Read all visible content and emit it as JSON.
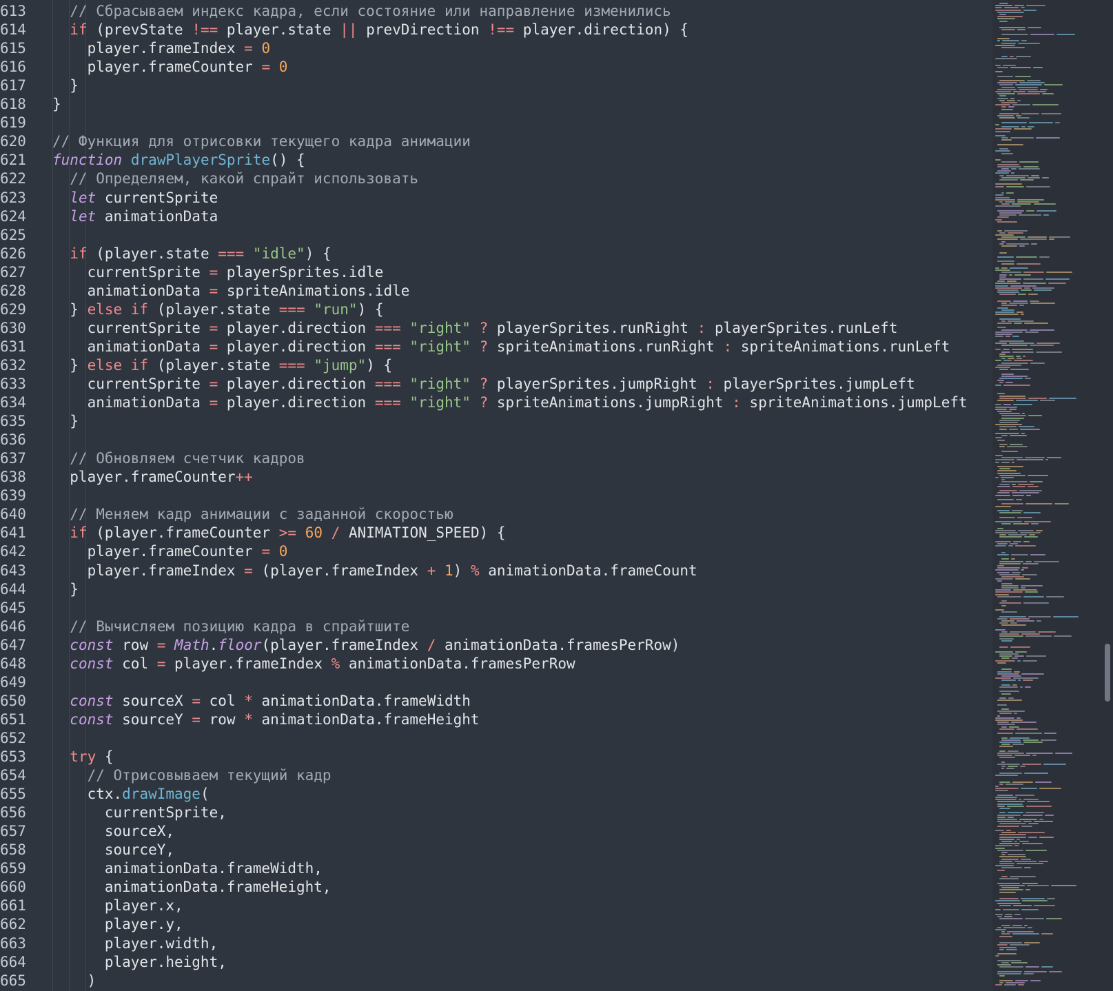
{
  "editor": {
    "lines": [
      {
        "n": "613",
        "t": [
          [
            "cm",
            "  // Сбрасываем индекс кадра, если состояние или направление изменились"
          ]
        ]
      },
      {
        "n": "614",
        "t": [
          [
            "pl",
            "  "
          ],
          [
            "kw",
            "if"
          ],
          [
            "pl",
            " (prevState "
          ],
          [
            "op",
            "!=="
          ],
          [
            "pl",
            " player.state "
          ],
          [
            "op",
            "||"
          ],
          [
            "pl",
            " prevDirection "
          ],
          [
            "op",
            "!=="
          ],
          [
            "pl",
            " player.direction) {"
          ]
        ]
      },
      {
        "n": "615",
        "t": [
          [
            "pl",
            "    player.frameIndex "
          ],
          [
            "op",
            "="
          ],
          [
            "pl",
            " "
          ],
          [
            "num",
            "0"
          ]
        ]
      },
      {
        "n": "616",
        "t": [
          [
            "pl",
            "    player.frameCounter "
          ],
          [
            "op",
            "="
          ],
          [
            "pl",
            " "
          ],
          [
            "num",
            "0"
          ]
        ]
      },
      {
        "n": "617",
        "t": [
          [
            "pl",
            "  }"
          ]
        ]
      },
      {
        "n": "618",
        "t": [
          [
            "pl",
            "}"
          ]
        ]
      },
      {
        "n": "619",
        "t": []
      },
      {
        "n": "620",
        "t": [
          [
            "cm",
            "// Функция для отрисовки текущего кадра анимации"
          ]
        ]
      },
      {
        "n": "621",
        "t": [
          [
            "sk",
            "function"
          ],
          [
            "pl",
            " "
          ],
          [
            "fn",
            "drawPlayerSprite"
          ],
          [
            "pl",
            "() {"
          ]
        ]
      },
      {
        "n": "622",
        "t": [
          [
            "cm",
            "  // Определяем, какой спрайт использовать"
          ]
        ]
      },
      {
        "n": "623",
        "t": [
          [
            "pl",
            "  "
          ],
          [
            "sk",
            "let"
          ],
          [
            "pl",
            " currentSprite"
          ]
        ]
      },
      {
        "n": "624",
        "t": [
          [
            "pl",
            "  "
          ],
          [
            "sk",
            "let"
          ],
          [
            "pl",
            " animationData"
          ]
        ]
      },
      {
        "n": "625",
        "t": []
      },
      {
        "n": "626",
        "t": [
          [
            "pl",
            "  "
          ],
          [
            "kw",
            "if"
          ],
          [
            "pl",
            " (player.state "
          ],
          [
            "op",
            "==="
          ],
          [
            "pl",
            " "
          ],
          [
            "str",
            "\"idle\""
          ],
          [
            "pl",
            ") {"
          ]
        ]
      },
      {
        "n": "627",
        "t": [
          [
            "pl",
            "    currentSprite "
          ],
          [
            "op",
            "="
          ],
          [
            "pl",
            " playerSprites.idle"
          ]
        ]
      },
      {
        "n": "628",
        "t": [
          [
            "pl",
            "    animationData "
          ],
          [
            "op",
            "="
          ],
          [
            "pl",
            " spriteAnimations.idle"
          ]
        ]
      },
      {
        "n": "629",
        "t": [
          [
            "pl",
            "  } "
          ],
          [
            "kw",
            "else if"
          ],
          [
            "pl",
            " (player.state "
          ],
          [
            "op",
            "==="
          ],
          [
            "pl",
            " "
          ],
          [
            "str",
            "\"run\""
          ],
          [
            "pl",
            ") {"
          ]
        ]
      },
      {
        "n": "630",
        "t": [
          [
            "pl",
            "    currentSprite "
          ],
          [
            "op",
            "="
          ],
          [
            "pl",
            " player.direction "
          ],
          [
            "op",
            "==="
          ],
          [
            "pl",
            " "
          ],
          [
            "str",
            "\"right\""
          ],
          [
            "pl",
            " "
          ],
          [
            "op",
            "?"
          ],
          [
            "pl",
            " playerSprites.runRight "
          ],
          [
            "op",
            ":"
          ],
          [
            "pl",
            " playerSprites.runLeft"
          ]
        ]
      },
      {
        "n": "631",
        "t": [
          [
            "pl",
            "    animationData "
          ],
          [
            "op",
            "="
          ],
          [
            "pl",
            " player.direction "
          ],
          [
            "op",
            "==="
          ],
          [
            "pl",
            " "
          ],
          [
            "str",
            "\"right\""
          ],
          [
            "pl",
            " "
          ],
          [
            "op",
            "?"
          ],
          [
            "pl",
            " spriteAnimations.runRight "
          ],
          [
            "op",
            ":"
          ],
          [
            "pl",
            " spriteAnimations.runLeft"
          ]
        ]
      },
      {
        "n": "632",
        "t": [
          [
            "pl",
            "  } "
          ],
          [
            "kw",
            "else if"
          ],
          [
            "pl",
            " (player.state "
          ],
          [
            "op",
            "==="
          ],
          [
            "pl",
            " "
          ],
          [
            "str",
            "\"jump\""
          ],
          [
            "pl",
            ") {"
          ]
        ]
      },
      {
        "n": "633",
        "t": [
          [
            "pl",
            "    currentSprite "
          ],
          [
            "op",
            "="
          ],
          [
            "pl",
            " player.direction "
          ],
          [
            "op",
            "==="
          ],
          [
            "pl",
            " "
          ],
          [
            "str",
            "\"right\""
          ],
          [
            "pl",
            " "
          ],
          [
            "op",
            "?"
          ],
          [
            "pl",
            " playerSprites.jumpRight "
          ],
          [
            "op",
            ":"
          ],
          [
            "pl",
            " playerSprites.jumpLeft"
          ]
        ]
      },
      {
        "n": "634",
        "t": [
          [
            "pl",
            "    animationData "
          ],
          [
            "op",
            "="
          ],
          [
            "pl",
            " player.direction "
          ],
          [
            "op",
            "==="
          ],
          [
            "pl",
            " "
          ],
          [
            "str",
            "\"right\""
          ],
          [
            "pl",
            " "
          ],
          [
            "op",
            "?"
          ],
          [
            "pl",
            " spriteAnimations.jumpRight "
          ],
          [
            "op",
            ":"
          ],
          [
            "pl",
            " spriteAnimations.jumpLeft"
          ]
        ]
      },
      {
        "n": "635",
        "t": [
          [
            "pl",
            "  }"
          ]
        ]
      },
      {
        "n": "636",
        "t": []
      },
      {
        "n": "637",
        "t": [
          [
            "cm",
            "  // Обновляем счетчик кадров"
          ]
        ]
      },
      {
        "n": "638",
        "t": [
          [
            "pl",
            "  player.frameCounter"
          ],
          [
            "op",
            "++"
          ]
        ]
      },
      {
        "n": "639",
        "t": []
      },
      {
        "n": "640",
        "t": [
          [
            "cm",
            "  // Меняем кадр анимации с заданной скоростью"
          ]
        ]
      },
      {
        "n": "641",
        "t": [
          [
            "pl",
            "  "
          ],
          [
            "kw",
            "if"
          ],
          [
            "pl",
            " (player.frameCounter "
          ],
          [
            "op",
            ">="
          ],
          [
            "pl",
            " "
          ],
          [
            "num",
            "60"
          ],
          [
            "pl",
            " "
          ],
          [
            "op",
            "/"
          ],
          [
            "pl",
            " ANIMATION_SPEED) {"
          ]
        ]
      },
      {
        "n": "642",
        "t": [
          [
            "pl",
            "    player.frameCounter "
          ],
          [
            "op",
            "="
          ],
          [
            "pl",
            " "
          ],
          [
            "num",
            "0"
          ]
        ]
      },
      {
        "n": "643",
        "t": [
          [
            "pl",
            "    player.frameIndex "
          ],
          [
            "op",
            "="
          ],
          [
            "pl",
            " (player.frameIndex "
          ],
          [
            "op",
            "+"
          ],
          [
            "pl",
            " "
          ],
          [
            "num",
            "1"
          ],
          [
            "pl",
            ") "
          ],
          [
            "op",
            "%"
          ],
          [
            "pl",
            " animationData.frameCount"
          ]
        ]
      },
      {
        "n": "644",
        "t": [
          [
            "pl",
            "  }"
          ]
        ]
      },
      {
        "n": "645",
        "t": []
      },
      {
        "n": "646",
        "t": [
          [
            "cm",
            "  // Вычисляем позицию кадра в спрайтшите"
          ]
        ]
      },
      {
        "n": "647",
        "t": [
          [
            "pl",
            "  "
          ],
          [
            "sk",
            "const"
          ],
          [
            "pl",
            " row "
          ],
          [
            "op",
            "="
          ],
          [
            "pl",
            " "
          ],
          [
            "ifn",
            "Math"
          ],
          [
            "pl",
            "."
          ],
          [
            "ifn",
            "floor"
          ],
          [
            "pl",
            "(player.frameIndex "
          ],
          [
            "op",
            "/"
          ],
          [
            "pl",
            " animationData.framesPerRow)"
          ]
        ]
      },
      {
        "n": "648",
        "t": [
          [
            "pl",
            "  "
          ],
          [
            "sk",
            "const"
          ],
          [
            "pl",
            " col "
          ],
          [
            "op",
            "="
          ],
          [
            "pl",
            " player.frameIndex "
          ],
          [
            "op",
            "%"
          ],
          [
            "pl",
            " animationData.framesPerRow"
          ]
        ]
      },
      {
        "n": "649",
        "t": []
      },
      {
        "n": "650",
        "t": [
          [
            "pl",
            "  "
          ],
          [
            "sk",
            "const"
          ],
          [
            "pl",
            " sourceX "
          ],
          [
            "op",
            "="
          ],
          [
            "pl",
            " col "
          ],
          [
            "op",
            "*"
          ],
          [
            "pl",
            " animationData.frameWidth"
          ]
        ]
      },
      {
        "n": "651",
        "t": [
          [
            "pl",
            "  "
          ],
          [
            "sk",
            "const"
          ],
          [
            "pl",
            " sourceY "
          ],
          [
            "op",
            "="
          ],
          [
            "pl",
            " row "
          ],
          [
            "op",
            "*"
          ],
          [
            "pl",
            " animationData.frameHeight"
          ]
        ]
      },
      {
        "n": "652",
        "t": []
      },
      {
        "n": "653",
        "t": [
          [
            "pl",
            "  "
          ],
          [
            "kw",
            "try"
          ],
          [
            "pl",
            " {"
          ]
        ]
      },
      {
        "n": "654",
        "t": [
          [
            "cm",
            "    // Отрисовываем текущий кадр"
          ]
        ]
      },
      {
        "n": "655",
        "t": [
          [
            "pl",
            "    ctx."
          ],
          [
            "fn",
            "drawImage"
          ],
          [
            "pl",
            "("
          ]
        ]
      },
      {
        "n": "656",
        "t": [
          [
            "pl",
            "      currentSprite,"
          ]
        ]
      },
      {
        "n": "657",
        "t": [
          [
            "pl",
            "      sourceX,"
          ]
        ]
      },
      {
        "n": "658",
        "t": [
          [
            "pl",
            "      sourceY,"
          ]
        ]
      },
      {
        "n": "659",
        "t": [
          [
            "pl",
            "      animationData.frameWidth,"
          ]
        ]
      },
      {
        "n": "660",
        "t": [
          [
            "pl",
            "      animationData.frameHeight,"
          ]
        ]
      },
      {
        "n": "661",
        "t": [
          [
            "pl",
            "      player.x,"
          ]
        ]
      },
      {
        "n": "662",
        "t": [
          [
            "pl",
            "      player.y,"
          ]
        ]
      },
      {
        "n": "663",
        "t": [
          [
            "pl",
            "      player.width,"
          ]
        ]
      },
      {
        "n": "664",
        "t": [
          [
            "pl",
            "      player.height,"
          ]
        ]
      },
      {
        "n": "665",
        "t": [
          [
            "pl",
            "    )"
          ]
        ]
      }
    ]
  },
  "colors": {
    "background": "#2f353e",
    "comment": "#a3aab4",
    "keyword": "#f08a8a",
    "storage": "#c8a0e8",
    "string": "#98c688",
    "number": "#f5a55a",
    "function": "#6fb5d3",
    "text": "#e1e4e8"
  },
  "minimap": {
    "visible": true
  },
  "scrollbar": {
    "position": 0.67
  }
}
